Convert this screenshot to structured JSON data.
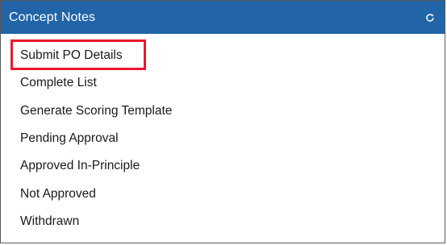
{
  "panel": {
    "title": "Concept Notes",
    "refresh_icon": "refresh-icon",
    "header_color": "#2164a8"
  },
  "menu": {
    "items": [
      {
        "label": "Submit PO Details",
        "highlighted": true
      },
      {
        "label": "Complete List"
      },
      {
        "label": "Generate Scoring Template"
      },
      {
        "label": "Pending Approval"
      },
      {
        "label": "Approved In-Principle"
      },
      {
        "label": "Not Approved"
      },
      {
        "label": "Withdrawn"
      }
    ],
    "highlight_color": "#e8192c"
  }
}
